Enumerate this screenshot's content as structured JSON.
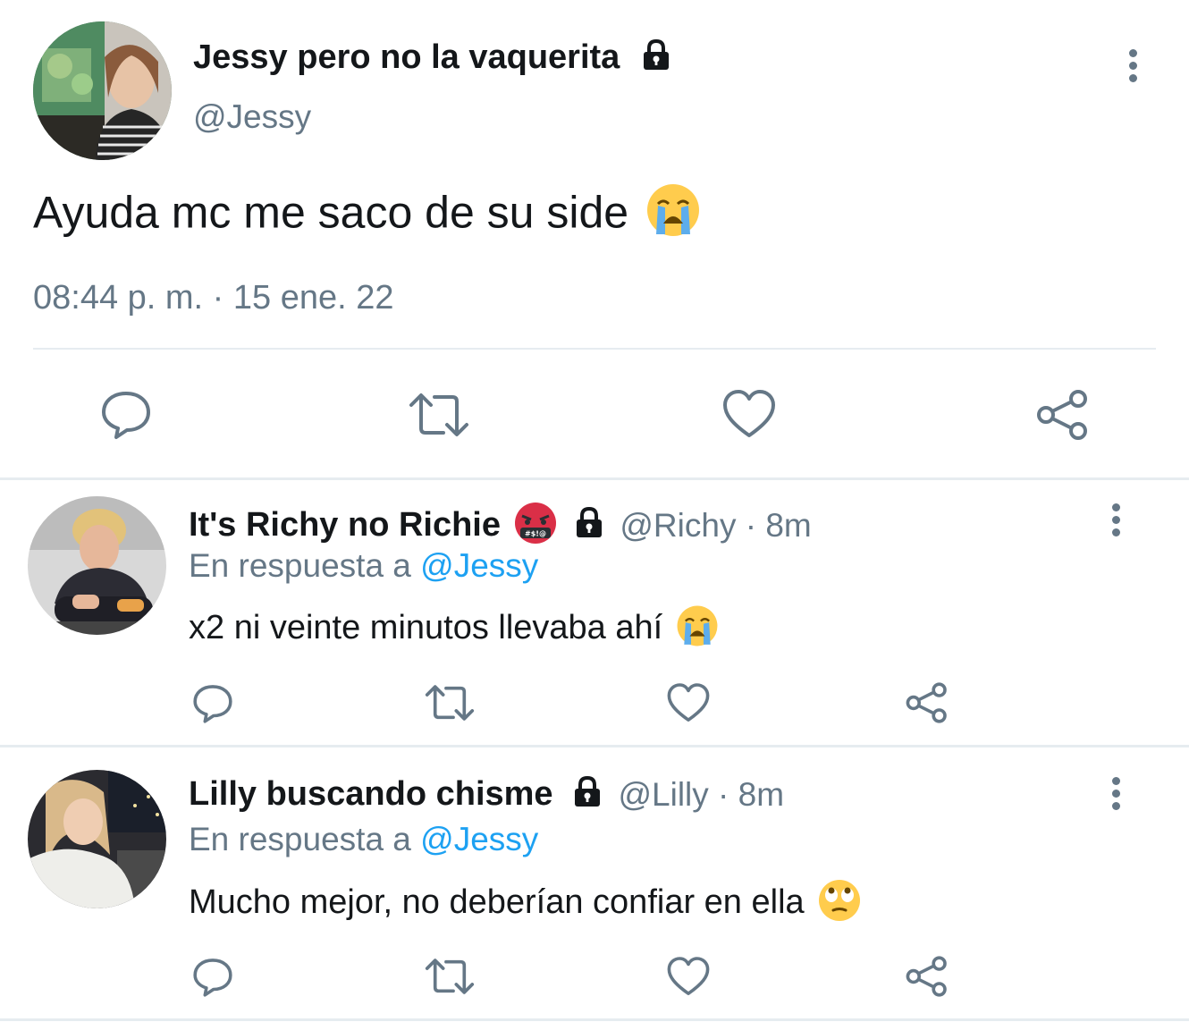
{
  "main_tweet": {
    "display_name": "Jessy pero no la vaquerita",
    "handle": "@Jessy",
    "text": "Ayuda mc me saco de su side",
    "emoji_icon": "loudly-crying-face-emoji",
    "timestamp": "08:44 p. m. · 15 ene. 22",
    "locked": true
  },
  "replies": [
    {
      "display_name": "It's Richy no Richie",
      "name_emoji_icon": "face-with-symbols-on-mouth-emoji",
      "handle_time": "@Richy · 8m",
      "reply_prefix": "En respuesta a",
      "reply_to": "@Jessy",
      "text": "x2 ni veinte minutos llevaba ahí",
      "emoji_icon": "loudly-crying-face-emoji",
      "locked": true
    },
    {
      "display_name": "Lilly buscando chisme",
      "handle_time": "@Lilly · 8m",
      "reply_prefix": "En respuesta a",
      "reply_to": "@Jessy",
      "text": "Mucho mejor, no deberían confiar en ella",
      "emoji_icon": "face-with-rolling-eyes-emoji",
      "locked": true
    }
  ],
  "icons": {
    "reply": "speech-bubble-icon",
    "retweet": "retweet-icon",
    "like": "heart-icon",
    "share": "share-icon",
    "more": "kebab-menu-icon",
    "lock": "lock-icon"
  },
  "colors": {
    "link": "#1da1f2",
    "muted": "#657786",
    "divider": "#e6ecf0",
    "text": "#14171a"
  }
}
